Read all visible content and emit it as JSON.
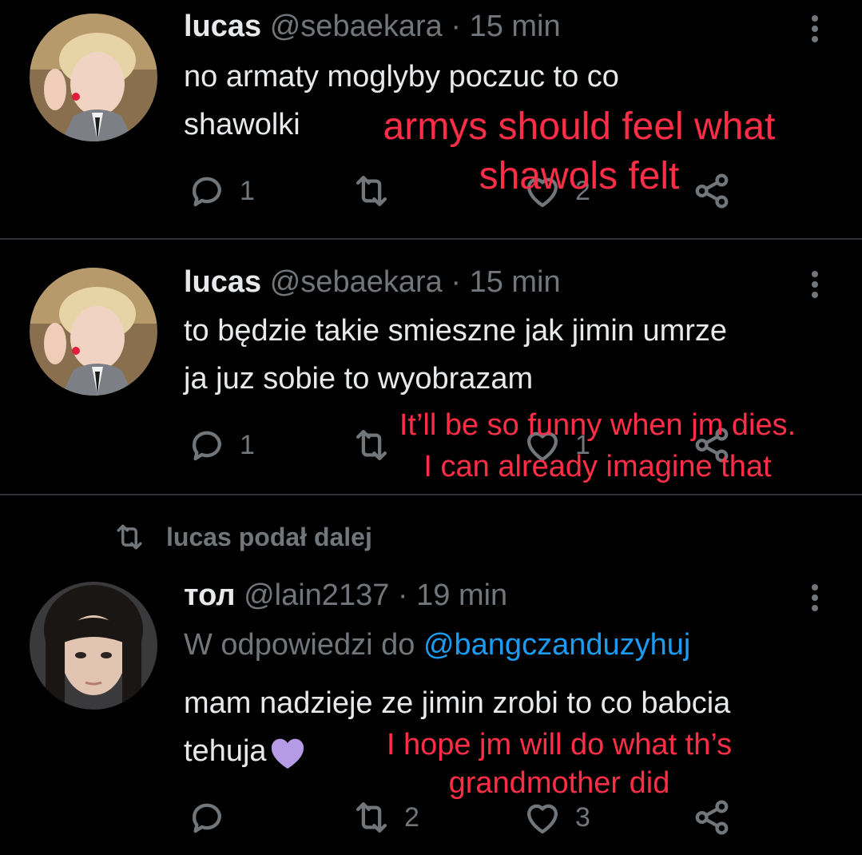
{
  "tweets": [
    {
      "name": "lucas",
      "handle": "@sebaekara",
      "dot": "·",
      "time": "15 min",
      "text_lines": [
        "no armaty moglyby poczuc to co",
        "shawolki"
      ],
      "replies": "1",
      "retweets": "",
      "likes": "2",
      "overlay_lines": [
        "armys should feel what",
        "shawols felt"
      ]
    },
    {
      "name": "lucas",
      "handle": "@sebaekara",
      "dot": "·",
      "time": "15 min",
      "text_lines": [
        "to będzie takie smieszne jak jimin umrze",
        "ja juz sobie to wyobrazam"
      ],
      "replies": "1",
      "retweets": "",
      "likes": "1",
      "overlay_lines": [
        "It’ll be so funny when jm dies.",
        "I can already imagine that"
      ]
    },
    {
      "retweet_banner": "lucas podał dalej",
      "name": "тол",
      "handle": "@lain2137",
      "dot": "·",
      "time": "19 min",
      "reply_prefix": "W odpowiedzi do",
      "reply_mention": "@bangczanduzyhuj",
      "text_lines": [
        "mam nadzieje ze jimin zrobi to co babcia",
        "tehuja"
      ],
      "replies": "",
      "retweets": "2",
      "likes": "3",
      "overlay_lines": [
        "I hope jm will do what th’s",
        "grandmother did"
      ]
    }
  ],
  "icons": {
    "reply": "reply-icon",
    "retweet": "retweet-icon",
    "like": "heart-icon",
    "share": "share-icon",
    "more": "more-vertical-icon",
    "purple_heart": "purple-heart-emoji"
  },
  "colors": {
    "background": "#000000",
    "text": "#e7e9ea",
    "muted": "#71767b",
    "link": "#1d9bf0",
    "overlay": "#ff2d46",
    "purple_heart": "#b59ae6"
  }
}
